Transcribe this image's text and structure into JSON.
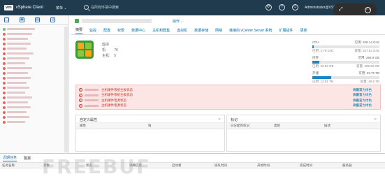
{
  "header": {
    "logo": "vm",
    "app_title": "vSphere Client",
    "menu_label": "菜单 ⌄",
    "search_placeholder": "在所有环境中搜索",
    "user": "Administrator@VSPHERE.LOCAL ⌄"
  },
  "host": {
    "actions_label": "操作 ⌄"
  },
  "tabs": [
    {
      "label": "摘要"
    },
    {
      "label": "监控"
    },
    {
      "label": "配置"
    },
    {
      "label": "权限"
    },
    {
      "label": "数据中心"
    },
    {
      "label": "主机和群集"
    },
    {
      "label": "虚拟机"
    },
    {
      "label": "数据存储"
    },
    {
      "label": "网络"
    },
    {
      "label": "链接的 vCenter Server 系统"
    },
    {
      "label": "扩展插件"
    },
    {
      "label": "更新"
    }
  ],
  "summary": {
    "rows": [
      {
        "key": "虚拟机:",
        "value": "76"
      },
      {
        "key": "主机:",
        "value": "5"
      }
    ]
  },
  "resources": [
    {
      "name": "CPU",
      "free": "可用: 208.14 GHz",
      "used": "已用: 2.79 GHz",
      "capacity": "容量: 207.53 GHz",
      "fill": 0.02
    },
    {
      "name": "内存",
      "free": "可用: 266.6 GB",
      "used": "已用: 22.92 GB",
      "capacity": "容量: 289.62 GB",
      "fill": 0.1
    },
    {
      "name": "存储",
      "free": "可用: 33.79 TB",
      "used": "已用: 12.81 TB",
      "capacity": "容量: 46.6 TB",
      "fill": 0.28
    }
  ],
  "alerts": [
    {
      "message": "主机硬件系统主板状态",
      "ack": "确认",
      "reset": "重置为绿色"
    },
    {
      "message": "主机硬件系统主板状态",
      "ack": "确认",
      "reset": "重置为绿色"
    },
    {
      "message": "主机硬件电源状态",
      "ack": "确认",
      "reset": "重置为绿色"
    },
    {
      "message": "主机硬件电源状态",
      "ack": "确认",
      "reset": "重置为绿色"
    }
  ],
  "custom_attrs": {
    "title": "自定义属性",
    "col1": "属性",
    "col2": "值"
  },
  "tags": {
    "title": "标记",
    "col1": "已分配的标记",
    "col2": "类别",
    "col3": "描述"
  },
  "bottom": {
    "tab1": "近期任务",
    "tab2": "警报",
    "columns": [
      "任务名称",
      "对象",
      "状态",
      "详细信息",
      "启动者",
      "排队时间",
      "开始时间",
      "完成时间",
      "服务器"
    ]
  },
  "watermark": "FREEBUF"
}
